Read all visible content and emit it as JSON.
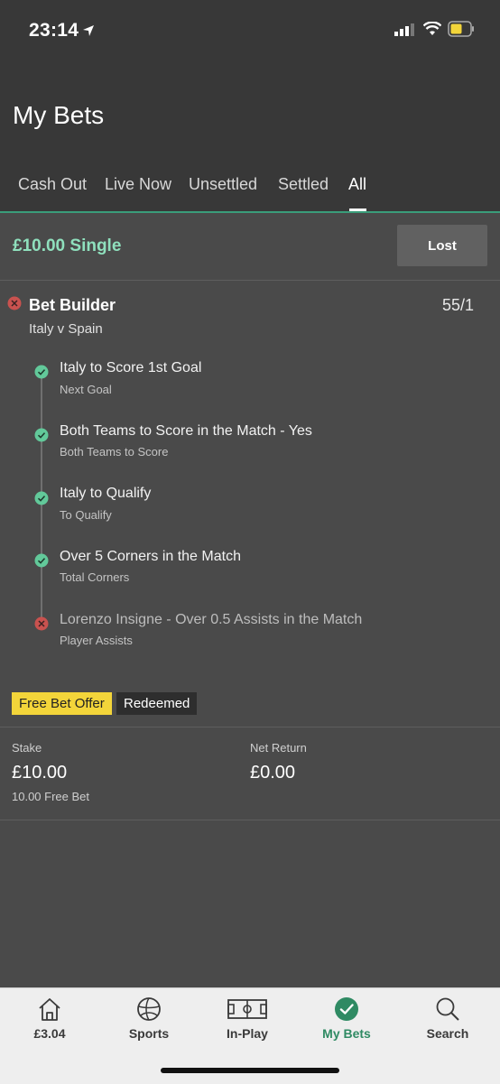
{
  "status_bar": {
    "time": "23:14"
  },
  "header": {
    "title": "My Bets"
  },
  "tabs": [
    {
      "label": "Cash Out"
    },
    {
      "label": "Live Now"
    },
    {
      "label": "Unsettled"
    },
    {
      "label": "Settled"
    },
    {
      "label": "All"
    }
  ],
  "active_tab": "All",
  "bet": {
    "title": "£10.00 Single",
    "status_button": "Lost",
    "builder": {
      "title": "Bet Builder",
      "odds": "55/1",
      "match": "Italy v Spain"
    },
    "selections": [
      {
        "name": "Italy to Score 1st Goal",
        "market": "Next Goal",
        "result": "won"
      },
      {
        "name": "Both Teams to Score in the Match - Yes",
        "market": "Both Teams to Score",
        "result": "won"
      },
      {
        "name": "Italy to Qualify",
        "market": "To Qualify",
        "result": "won"
      },
      {
        "name": "Over 5 Corners in the Match",
        "market": "Total Corners",
        "result": "won"
      },
      {
        "name": "Lorenzo Insigne - Over 0.5 Assists in the Match",
        "market": "Player Assists",
        "result": "lost"
      }
    ],
    "offer": {
      "label": "Free Bet Offer",
      "status": "Redeemed"
    },
    "stake": {
      "label": "Stake",
      "value": "£10.00",
      "note": "10.00 Free Bet"
    },
    "net_return": {
      "label": "Net Return",
      "value": "£0.00"
    }
  },
  "bottom_nav": [
    {
      "label": "£3.04",
      "icon": "home-icon"
    },
    {
      "label": "Sports",
      "icon": "football-icon"
    },
    {
      "label": "In-Play",
      "icon": "pitch-icon"
    },
    {
      "label": "My Bets",
      "icon": "check-circle-icon"
    },
    {
      "label": "Search",
      "icon": "search-icon"
    }
  ],
  "colors": {
    "accent_green": "#8fe0bd",
    "won_icon": "#62c99a",
    "lost_icon": "#c9524f",
    "offer_yellow": "#f3d53a",
    "nav_active": "#2f8a63"
  }
}
